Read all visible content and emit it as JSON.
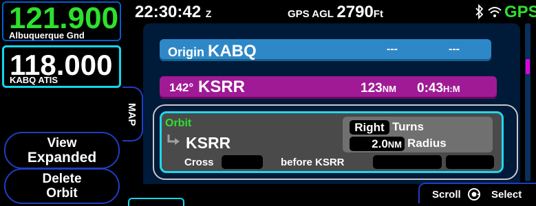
{
  "radio": {
    "active_freq": "121.900",
    "active_name": "Albuquerque Gnd",
    "standby_freq": "118.000",
    "standby_name": "KABQ ATIS"
  },
  "status": {
    "time": "22:30:42",
    "time_zone": "Z",
    "agl_label": "GPS AGL",
    "agl_value": "2790",
    "agl_unit": "Ft",
    "gps_label": "GPS",
    "icons": [
      "bluetooth-icon",
      "wifi-icon"
    ]
  },
  "side_tab": {
    "label": "MAP"
  },
  "softkeys": {
    "view_line1": "View",
    "view_line2": "Expanded",
    "delete_line1": "Delete",
    "delete_line2": "Orbit"
  },
  "flight_plan": {
    "origin": {
      "label": "Origin",
      "ident": "KABQ",
      "dist": "---",
      "ete": "---"
    },
    "leg": {
      "course": "142°",
      "ident": "KSRR",
      "dist": "123",
      "dist_unit": "NM",
      "ete": "0:43",
      "ete_unit": "H:M"
    },
    "orbit": {
      "title": "Orbit",
      "waypoint": "KSRR",
      "turn_value": "Right",
      "turn_label": "Turns",
      "radius_value": "2.0",
      "radius_unit": "NM",
      "radius_label": "Radius",
      "cross_label": "Cross",
      "before_label": "before KSRR"
    }
  },
  "footer": {
    "scroll_label": "Scroll",
    "select_label": "Select"
  },
  "colors": {
    "active_green": "#2ee02e",
    "origin_blue": "#2e88c8",
    "leg_magenta": "#a01a96",
    "cyan_highlight": "#20d8e8"
  }
}
